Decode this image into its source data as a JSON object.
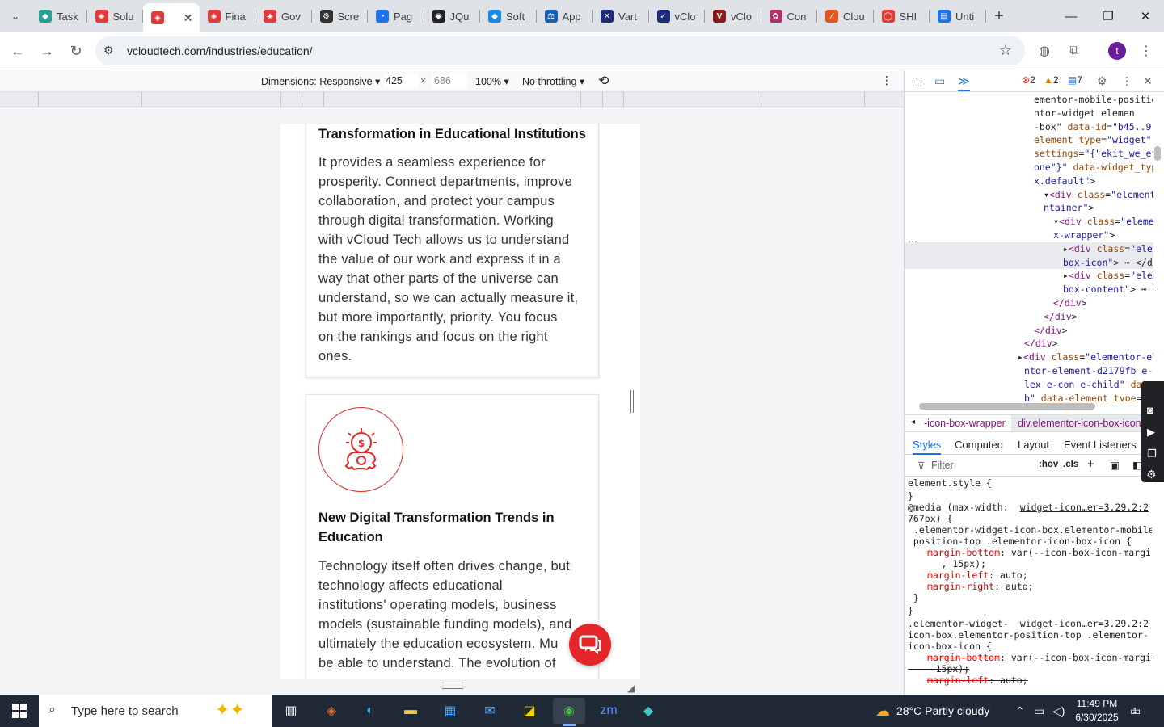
{
  "browser": {
    "tabs": [
      {
        "label": "Task",
        "color": "#2aa198",
        "glyph": "◆"
      },
      {
        "label": "Solu",
        "color": "#e03b3b",
        "glyph": "◈"
      },
      {
        "label": "",
        "color": "#e03b3b",
        "glyph": "◈",
        "active": true
      },
      {
        "label": "Fina",
        "color": "#e03b3b",
        "glyph": "◈"
      },
      {
        "label": "Gov",
        "color": "#e03b3b",
        "glyph": "◈"
      },
      {
        "label": "Scre",
        "color": "#333333",
        "glyph": "⚙"
      },
      {
        "label": "Pag",
        "color": "#1a73e8",
        "glyph": "◔"
      },
      {
        "label": "JQu",
        "color": "#222222",
        "glyph": "◉"
      },
      {
        "label": "Soft",
        "color": "#1e88e5",
        "glyph": "◆"
      },
      {
        "label": "App",
        "color": "#1a5fb4",
        "glyph": "⚖"
      },
      {
        "label": "Vart",
        "color": "#1c2b7a",
        "glyph": "✕"
      },
      {
        "label": "vClo",
        "color": "#1c2b7a",
        "glyph": "✓"
      },
      {
        "label": "vClo",
        "color": "#8b1a1a",
        "glyph": "V"
      },
      {
        "label": "Con",
        "color": "#b0306a",
        "glyph": "✿"
      },
      {
        "label": "Clou",
        "color": "#e8541e",
        "glyph": "⁄"
      },
      {
        "label": "SHI",
        "color": "#e53935",
        "glyph": "◯"
      },
      {
        "label": "Unti",
        "color": "#1a73e8",
        "glyph": "▤"
      }
    ],
    "url": "vcloudtech.com/industries/education/",
    "profile_initial": "t"
  },
  "device_toolbar": {
    "dimensions_label": "Dimensions: Responsive",
    "width": "425",
    "times": "×",
    "height": "686",
    "zoom": "100%",
    "throttling": "No throttling"
  },
  "page": {
    "card1": {
      "title": "Transformation in Educational Institutions",
      "body": [
        "It provides a seamless experience for",
        "prosperity. Connect departments, improve",
        "collaboration, and protect your campus",
        "through digital transformation. Working",
        "with vCloud Tech allows us to understand",
        "the value of our work and express it in a",
        "way that other parts of the universe can",
        "understand, so we can actually measure it,",
        "but more importantly, priority. You focus",
        "on the rankings and focus on the right",
        "ones."
      ]
    },
    "card2": {
      "title_lines": [
        "New Digital Transformation Trends in",
        "Education"
      ],
      "body": [
        "Technology itself often drives change, but",
        "technology affects educational",
        "institutions' operating models, business",
        "models (sustainable funding models), and",
        "ultimately the education ecosystem. Mu",
        "be able to understand. The evolution of"
      ],
      "icon_accent": "#e02a2a"
    },
    "chat_color": "#e4262b"
  },
  "devtools": {
    "errors": "2",
    "warnings": "2",
    "messages": "7",
    "dom_lines": [
      {
        "indent": 160,
        "html": "ementor-mobile-positio"
      },
      {
        "indent": 160,
        "html": "ntor-widget elemen"
      },
      {
        "indent": 160,
        "html": "-box\" <a>data-id</a>=<v>\"b45..9</v>"
      },
      {
        "indent": 160,
        "html": "<a>element_type</a>=<v>\"widget\"</v>"
      },
      {
        "indent": 160,
        "html": "<a>settings</a>=<v>\"{\"ekit_we_ef</v>"
      },
      {
        "indent": 160,
        "html": "<v>one\"}\"</v> <a>data-widget_typ</a>"
      },
      {
        "indent": 160,
        "html": "<v>x.default\"</v>&gt;"
      },
      {
        "indent": 172,
        "html": "▾&lt;div <a>class</a>=<v>\"elementor</v>"
      },
      {
        "indent": 172,
        "html": "<v>ntainer\"</v>&gt;"
      },
      {
        "indent": 184,
        "html": "▾&lt;div <a>class</a>=<v>\"element</v>"
      },
      {
        "indent": 184,
        "html": "<v>x-wrapper\"</v>&gt;"
      },
      {
        "indent": 196,
        "html": "▸&lt;div <a>class</a>=<v>\"eleme</v>",
        "sel": true
      },
      {
        "indent": 196,
        "html": "<v>box-icon\"</v>&gt; ⋯ &lt;/di",
        "sel": true
      },
      {
        "indent": 196,
        "html": "▸&lt;div <a>class</a>=<v>\"eleme</v>"
      },
      {
        "indent": 196,
        "html": "<v>box-content\"</v>&gt; ⋯ &lt;"
      },
      {
        "indent": 184,
        "html": "&lt;/div&gt;"
      },
      {
        "indent": 172,
        "html": "&lt;/div&gt;"
      },
      {
        "indent": 160,
        "html": "&lt;/div&gt;"
      },
      {
        "indent": 148,
        "html": "&lt;/div&gt;"
      },
      {
        "indent": 140,
        "html": "▸&lt;div <a>class</a>=<v>\"elementor-el</v>"
      },
      {
        "indent": 148,
        "html": "<v>ntor-element-d2179fb e-c</v>"
      },
      {
        "indent": 148,
        "html": "<v>lex e-con e-child\"</v> <a>data-</a>"
      },
      {
        "indent": 148,
        "html": "<v>b\"</v> <a>data-element_type</a>=<v>\"</v>"
      }
    ],
    "breadcrumb_1": "-icon-box-wrapper",
    "breadcrumb_2": "div.elementor-icon-box-icon",
    "panel_tabs": [
      "Styles",
      "Computed",
      "Layout",
      "Event Listeners"
    ],
    "filter_placeholder": "Filter",
    "hov": ":hov",
    "cls": ".cls",
    "styles_lines": [
      {
        "t": "element.style {"
      },
      {
        "t": "}"
      },
      {
        "t": "@media (max-width:",
        "src": "widget-icon…er=3.29.2:2"
      },
      {
        "t": "767px) {"
      },
      {
        "t": " .elementor-widget-icon-box.elementor-mobile-"
      },
      {
        "t": " position-top .elementor-icon-box-icon {"
      },
      {
        "p": "margin-bottom",
        "v": "var(--icon-box-icon-margin"
      },
      {
        "t": "      , 15px);"
      },
      {
        "p": "margin-left",
        "v": "auto;"
      },
      {
        "p": "margin-right",
        "v": "auto;"
      },
      {
        "t": " }"
      },
      {
        "t": "}"
      },
      {
        "t": ".elementor-widget-",
        "src": "widget-icon…er=3.29.2:2"
      },
      {
        "t": "icon-box.elementor-position-top .elementor-"
      },
      {
        "t": "icon-box-icon {"
      },
      {
        "p": "margin-bottom",
        "v": "var(--icon-box-icon-margin,",
        "strike": true
      },
      {
        "t": "     15px);",
        "strike": true
      },
      {
        "p": "margin-left",
        "v": "auto;",
        "strike": true
      }
    ]
  },
  "taskbar": {
    "search_placeholder": "Type here to search",
    "weather": "28°C  Partly cloudy",
    "time": "11:49 PM",
    "date": "6/30/2025",
    "notification_count": "1"
  }
}
